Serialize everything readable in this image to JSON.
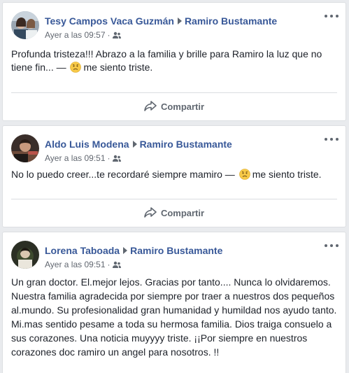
{
  "posts": [
    {
      "author": "Tesy Campos Vaca Guzmán",
      "recipient": "Ramiro Bustamante",
      "time": "Ayer a las 09:57",
      "separator": "·",
      "text_before": "Profunda tristeza!!! Abrazo a la familia y brille para Ramiro la luz que no tiene fin... —",
      "feeling": "me siento triste.",
      "share_label": "Compartir"
    },
    {
      "author": "Aldo Luis Modena",
      "recipient": "Ramiro Bustamante",
      "time": "Ayer a las 09:51",
      "separator": "·",
      "text_before": "No lo puedo creer...te recordaré siempre mamiro —",
      "feeling": "me siento triste.",
      "share_label": "Compartir"
    },
    {
      "author": "Lorena Taboada",
      "recipient": "Ramiro Bustamante",
      "time": "Ayer a las 09:51",
      "separator": "·",
      "text": "Un gran doctor. El.mejor lejos. Gracias por tanto.... Nunca lo olvidaremos. Nuestra familia agradecida por siempre por traer a nuestros dos pequeños al.mundo. Su profesionalidad gran humanidad y humildad nos ayudo tanto. Mi.mas sentido pesame a toda su hermosa familia. Dios traiga consuelo a sus corazones. Una noticia muyyyy triste. ¡¡Por siempre en nuestros corazones doc ramiro un angel para nosotros. !!"
    }
  ],
  "icons": {
    "friends": "friends-audience-icon",
    "more": "more-options-icon",
    "share": "share-arrow-icon",
    "sad": "sad-face-emoji-icon"
  },
  "colors": {
    "link": "#385898",
    "meta": "#616770",
    "background": "#e9ebee"
  }
}
